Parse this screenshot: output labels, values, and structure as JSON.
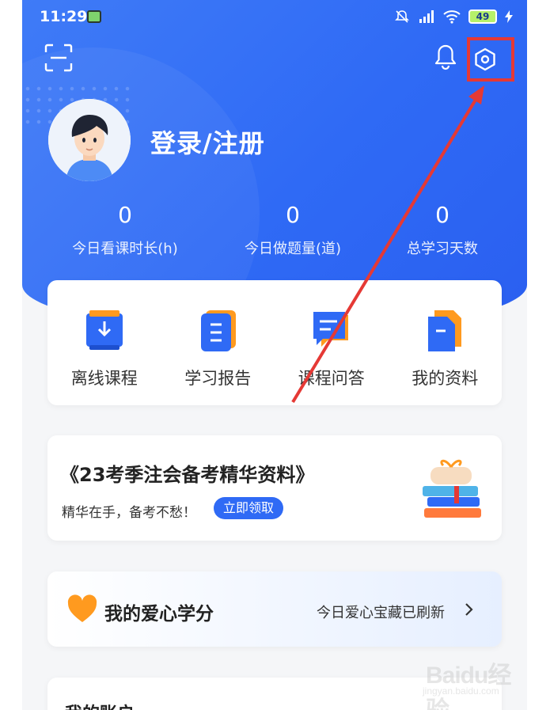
{
  "status_bar": {
    "time": "11:29",
    "battery": "49"
  },
  "profile": {
    "login_label": "登录/注册"
  },
  "stats": [
    {
      "value": "0",
      "label": "今日看课时长(h)"
    },
    {
      "value": "0",
      "label": "今日做题量(道)"
    },
    {
      "value": "0",
      "label": "总学习天数"
    }
  ],
  "menu": {
    "items": [
      {
        "label": "离线课程",
        "icon": "download-book-icon"
      },
      {
        "label": "学习报告",
        "icon": "report-icon"
      },
      {
        "label": "课程问答",
        "icon": "chat-icon"
      },
      {
        "label": "我的资料",
        "icon": "folder-icon"
      }
    ]
  },
  "promo": {
    "title": "《23考季注会备考精华资料》",
    "subtitle": "精华在手，备考不愁！",
    "button": "立即领取"
  },
  "love_credit": {
    "title": "我的爱心学分",
    "link": "今日爱心宝藏已刷新"
  },
  "bottom_card": {
    "title": "我的账户"
  },
  "watermark": {
    "line1": "Baidu经验",
    "line2": "jingyan.baidu.com"
  },
  "colors": {
    "primary": "#2f6af5",
    "annotation": "#e53935",
    "heart": "#ff9a1f"
  }
}
